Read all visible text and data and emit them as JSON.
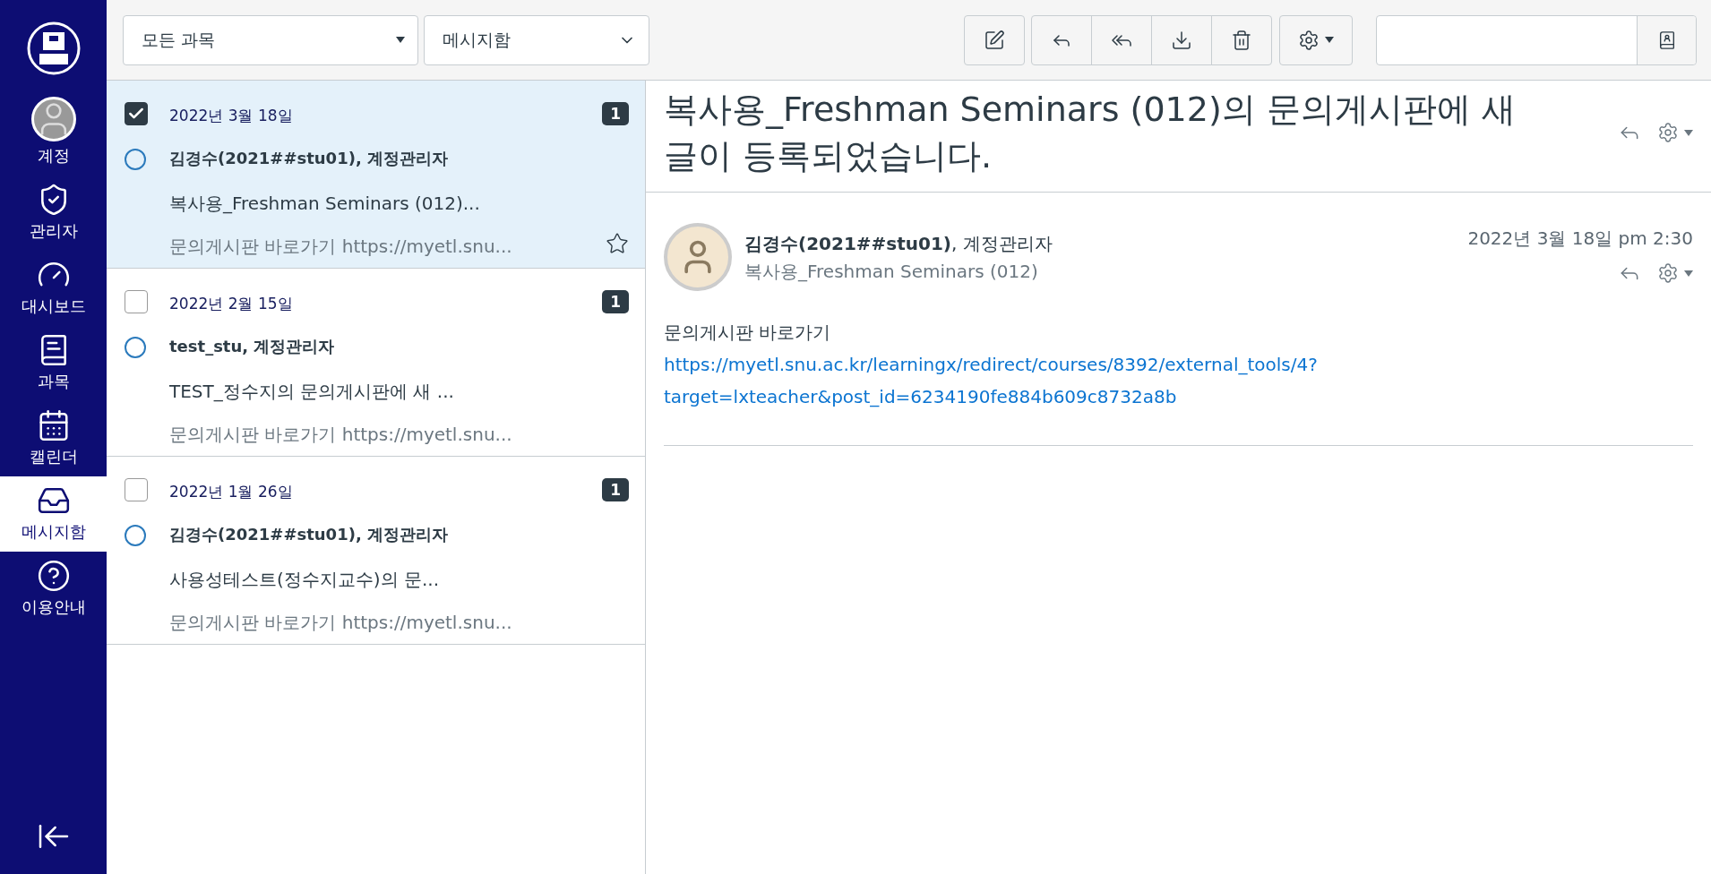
{
  "sidebar": {
    "items": [
      {
        "kind": "account",
        "label": "계정",
        "selected": false
      },
      {
        "kind": "admin",
        "label": "관리자",
        "selected": false
      },
      {
        "kind": "dashboard",
        "label": "대시보드",
        "selected": false
      },
      {
        "kind": "courses",
        "label": "과목",
        "selected": false
      },
      {
        "kind": "calendar",
        "label": "캘린더",
        "selected": false
      },
      {
        "kind": "inbox",
        "label": "메시지함",
        "selected": true
      },
      {
        "kind": "help",
        "label": "이용안내",
        "selected": false
      }
    ]
  },
  "toolbar": {
    "course_filter": "모든 과목",
    "mailbox_filter": "메시지함"
  },
  "conversations": [
    {
      "date": "2022년 3월 18일",
      "sender": "김경수(2021##stu01), 계정관리자",
      "subject": "복사용_Freshman Seminars (012)...",
      "preview": "문의게시판 바로가기 https://myetl.snu...",
      "count": "1",
      "checked": true,
      "selected": true,
      "read": true
    },
    {
      "date": "2022년 2월 15일",
      "sender": "test_stu, 계정관리자",
      "subject": "TEST_정수지의 문의게시판에 새 ...",
      "preview": "문의게시판 바로가기 https://myetl.snu...",
      "count": "1",
      "checked": false,
      "selected": false,
      "read": true
    },
    {
      "date": "2022년 1월 26일",
      "sender": "김경수(2021##stu01), 계정관리자",
      "subject": "사용성테스트(정수지교수)의 문...",
      "preview": "문의게시판 바로가기 https://myetl.snu...",
      "count": "1",
      "checked": false,
      "selected": false,
      "read": true
    }
  ],
  "message": {
    "title": "복사용_Freshman Seminars (012)의 문의게시판에 새 글이 등록되었습니다.",
    "sender": "**김경수(2021##stu01)**, 계정관리자",
    "course": "복사용_Freshman Seminars (012)",
    "time": "2022년 3월 18일 pm 2:30",
    "body": "문의게시판 바로가기",
    "link": "https://myetl.snu.ac.kr/learningx/redirect/courses/8392/external_tools/4?target=lxteacher&post_id=6234190fe884b609c8732a8b"
  }
}
